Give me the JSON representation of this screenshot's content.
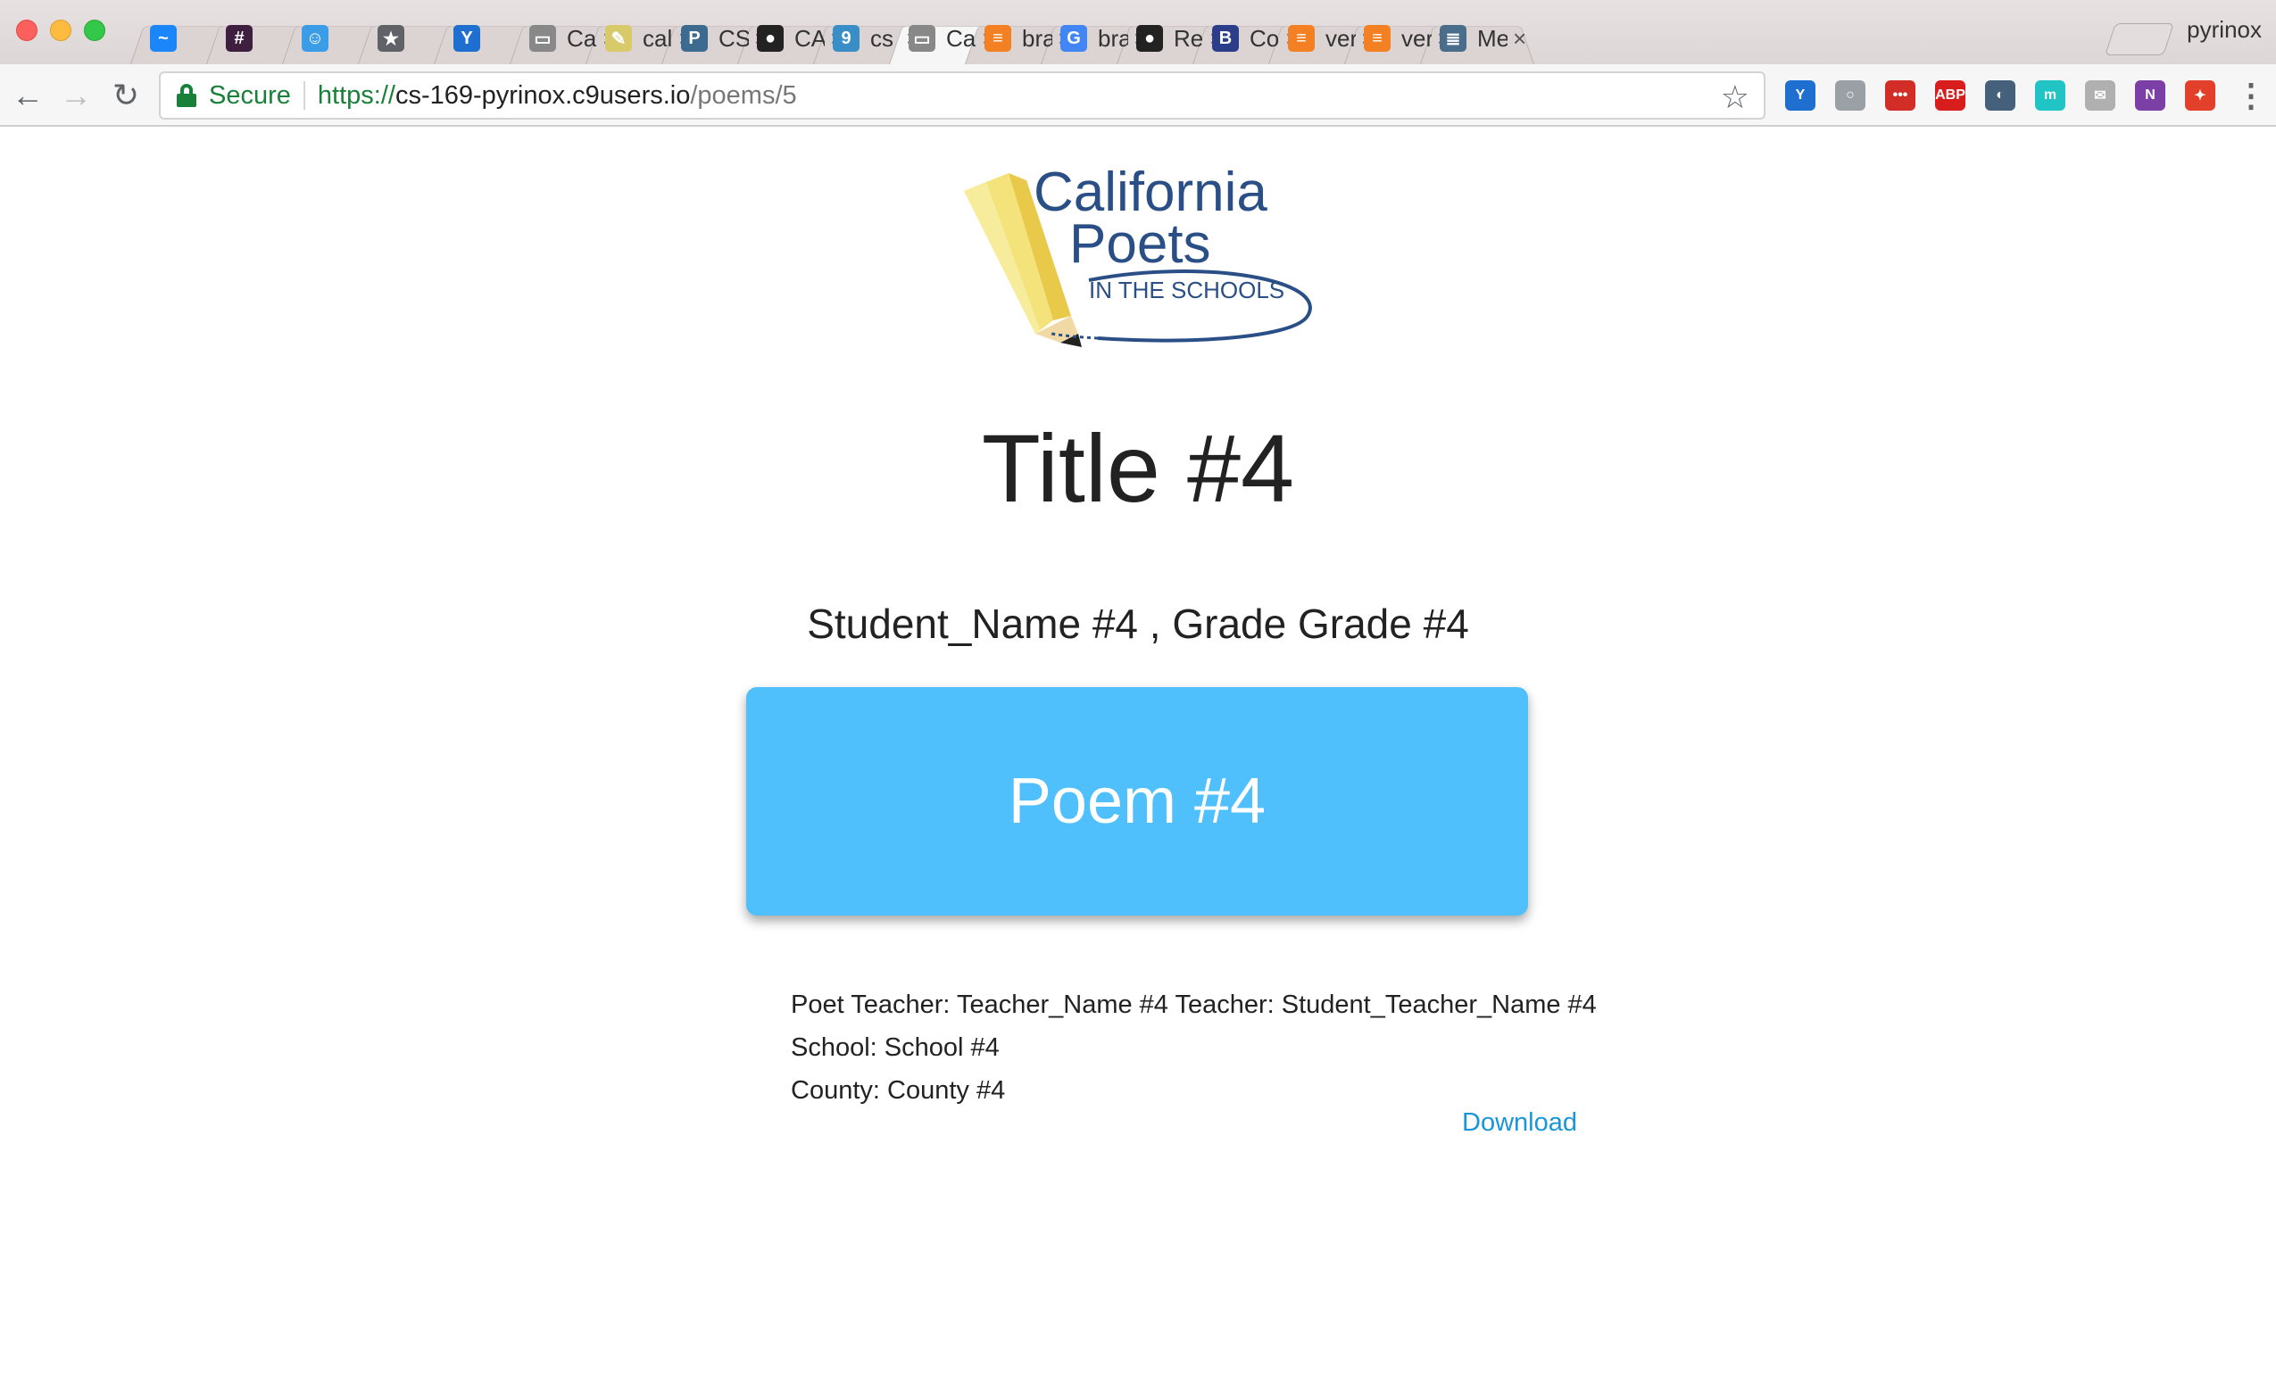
{
  "browser": {
    "profile_name": "pyrinox",
    "tabs": [
      {
        "title": "",
        "icon": "messenger-icon",
        "color": "#1b86f9",
        "glyph": "~"
      },
      {
        "title": "",
        "icon": "slack-icon",
        "color": "#3f1f40",
        "glyph": "#"
      },
      {
        "title": "",
        "icon": "piazza-icon",
        "color": "#3b9ce7",
        "glyph": "☺"
      },
      {
        "title": "",
        "icon": "bookmarks-star-icon",
        "color": "#5f6368",
        "glyph": "★"
      },
      {
        "title": "",
        "icon": "yesware-icon",
        "color": "#1e6fd0",
        "glyph": "Y"
      },
      {
        "title": "Ca",
        "icon": "page-icon",
        "color": "#888888",
        "glyph": "▭"
      },
      {
        "title": "cal",
        "icon": "cpits-logo-icon",
        "color": "#d8c96a",
        "glyph": "✎"
      },
      {
        "title": "CS",
        "icon": "pivotal-tracker-icon",
        "color": "#3d6b8f",
        "glyph": "P"
      },
      {
        "title": "CA",
        "icon": "github-icon",
        "color": "#222222",
        "glyph": "●"
      },
      {
        "title": "cs",
        "icon": "cloud9-icon",
        "color": "#3a8ec8",
        "glyph": "9"
      },
      {
        "title": "Ca",
        "icon": "page-icon",
        "color": "#888888",
        "glyph": "▭",
        "active": true
      },
      {
        "title": "bra",
        "icon": "stackoverflow-icon",
        "color": "#f48024",
        "glyph": "≡"
      },
      {
        "title": "bra",
        "icon": "google-icon",
        "color": "#4285f4",
        "glyph": "G"
      },
      {
        "title": "Re",
        "icon": "github-icon",
        "color": "#222222",
        "glyph": "●"
      },
      {
        "title": "Co",
        "icon": "bootstrap-icon",
        "color": "#2c3e8a",
        "glyph": "B"
      },
      {
        "title": "ver",
        "icon": "stackoverflow-icon",
        "color": "#f48024",
        "glyph": "≡"
      },
      {
        "title": "ver",
        "icon": "stackoverflow-icon",
        "color": "#f48024",
        "glyph": "≡"
      },
      {
        "title": "Me",
        "icon": "database-icon",
        "color": "#4a6d8c",
        "glyph": "≣"
      }
    ],
    "address": {
      "secure_label": "Secure",
      "scheme": "https://",
      "host": "cs-169-pyrinox.c9users.io",
      "path": "/poems/5"
    },
    "extensions": [
      {
        "name": "yesware-ext-icon",
        "color": "#1e6fd0",
        "glyph": "Y"
      },
      {
        "name": "magnifier-ext-icon",
        "color": "#9aa0a6",
        "glyph": "○"
      },
      {
        "name": "lastpass-ext-icon",
        "color": "#d32d27",
        "glyph": "•••"
      },
      {
        "name": "adblock-plus-ext-icon",
        "color": "#d81d1d",
        "glyph": "ABP"
      },
      {
        "name": "camera-ext-icon",
        "color": "#44607a",
        "glyph": "◐"
      },
      {
        "name": "mercury-ext-icon",
        "color": "#21c4c4",
        "glyph": "m"
      },
      {
        "name": "envelope-ext-icon",
        "color": "#b0b0b0",
        "glyph": "✉"
      },
      {
        "name": "onenote-ext-icon",
        "color": "#7b3fa6",
        "glyph": "N"
      },
      {
        "name": "pin-ext-icon",
        "color": "#e2402b",
        "glyph": "✦"
      }
    ]
  },
  "page": {
    "logo": {
      "line1": "California",
      "line2": "Poets",
      "line3": "IN THE SCHOOLS"
    },
    "title": "Title #4",
    "byline": "Student_Name #4 , Grade Grade #4",
    "poem": "Poem #4",
    "details": {
      "poet_teacher": "Poet Teacher: Teacher_Name #4 Teacher: Student_Teacher_Name #4",
      "school": "School: School #4",
      "county": "County: County #4"
    },
    "download_label": "Download"
  }
}
